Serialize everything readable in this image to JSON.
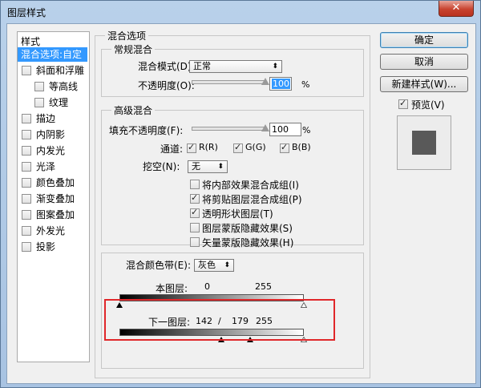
{
  "window": {
    "title": "图层样式",
    "close_symbol": "✕"
  },
  "styles": {
    "header": "样式",
    "items": [
      {
        "label": "混合选项:自定",
        "selected": true,
        "has_checkbox": false,
        "indent": false
      },
      {
        "label": "斜面和浮雕",
        "selected": false,
        "has_checkbox": true,
        "indent": false
      },
      {
        "label": "等高线",
        "selected": false,
        "has_checkbox": true,
        "indent": true
      },
      {
        "label": "纹理",
        "selected": false,
        "has_checkbox": true,
        "indent": true
      },
      {
        "label": "描边",
        "selected": false,
        "has_checkbox": true,
        "indent": false
      },
      {
        "label": "内阴影",
        "selected": false,
        "has_checkbox": true,
        "indent": false
      },
      {
        "label": "内发光",
        "selected": false,
        "has_checkbox": true,
        "indent": false
      },
      {
        "label": "光泽",
        "selected": false,
        "has_checkbox": true,
        "indent": false
      },
      {
        "label": "颜色叠加",
        "selected": false,
        "has_checkbox": true,
        "indent": false
      },
      {
        "label": "渐变叠加",
        "selected": false,
        "has_checkbox": true,
        "indent": false
      },
      {
        "label": "图案叠加",
        "selected": false,
        "has_checkbox": true,
        "indent": false
      },
      {
        "label": "外发光",
        "selected": false,
        "has_checkbox": true,
        "indent": false
      },
      {
        "label": "投影",
        "selected": false,
        "has_checkbox": true,
        "indent": false
      }
    ]
  },
  "blending": {
    "section_title": "混合选项",
    "general": {
      "title": "常规混合",
      "mode_label": "混合模式(D):",
      "mode_value": "正常",
      "opacity_label": "不透明度(O):",
      "opacity_value": "100",
      "opacity_fraction": 1.0,
      "percent": "%"
    },
    "advanced": {
      "title": "高级混合",
      "fill_label": "填充不透明度(F):",
      "fill_value": "100",
      "fill_fraction": 1.0,
      "percent": "%",
      "channels_label": "通道:",
      "channel_r": "R(R)",
      "channel_g": "G(G)",
      "channel_b": "B(B)",
      "knockout_label": "挖空(N):",
      "knockout_value": "无",
      "options": [
        {
          "label": "将内部效果混合成组(I)",
          "checked": false
        },
        {
          "label": "将剪贴图层混合成组(P)",
          "checked": true
        },
        {
          "label": "透明形状图层(T)",
          "checked": true
        },
        {
          "label": "图层蒙版隐藏效果(S)",
          "checked": false
        },
        {
          "label": "矢量蒙版隐藏效果(H)",
          "checked": false
        }
      ]
    },
    "blend_if": {
      "label": "混合颜色带(E):",
      "value": "灰色",
      "this_layer_label": "本图层:",
      "this_layer_low": "0",
      "this_layer_high": "255",
      "under_layer_label": "下一图层:",
      "under_low": "142",
      "slash": "/",
      "under_low_split": "179",
      "under_high": "255"
    }
  },
  "buttons": {
    "ok": "确定",
    "cancel": "取消",
    "new_style": "新建样式(W)...",
    "preview_label": "预览(V)",
    "preview_checked": true
  },
  "colors": {
    "selection": "#3399ff",
    "highlight_box": "#e0272a"
  }
}
